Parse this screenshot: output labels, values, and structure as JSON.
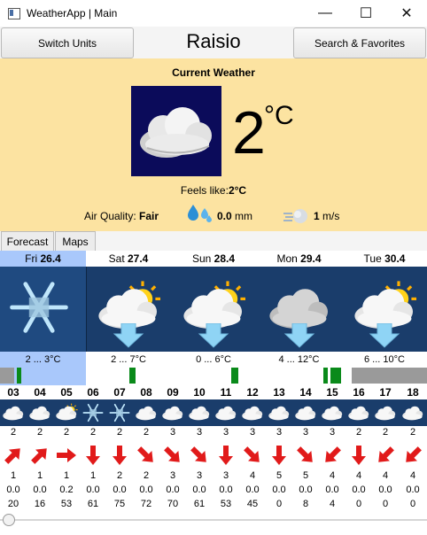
{
  "window": {
    "title": "WeatherApp | Main",
    "controls": {
      "minimize": "—",
      "maximize": "☐",
      "close": "✕"
    }
  },
  "header": {
    "switch_units": "Switch Units",
    "city": "Raisio",
    "search": "Search & Favorites"
  },
  "current": {
    "title": "Current Weather",
    "temp": "2",
    "unit": "°C",
    "feels_label": "Feels like:",
    "feels_value": "2°C",
    "aq_label": "Air Quality:",
    "aq_value": "Fair",
    "rain_value": "0.0",
    "rain_unit": "mm",
    "wind_value": "1",
    "wind_unit": "m/s"
  },
  "tabs": [
    "Forecast",
    "Maps"
  ],
  "days": [
    {
      "name": "Fri",
      "date": "26.4",
      "range": "2 ... 3°C",
      "icon": "snow-icon",
      "selected": true
    },
    {
      "name": "Sat",
      "date": "27.4",
      "range": "2 ... 7°C",
      "icon": "partly-cloudy-icon"
    },
    {
      "name": "Sun",
      "date": "28.4",
      "range": "0 ... 6°C",
      "icon": "partly-cloudy-icon"
    },
    {
      "name": "Mon",
      "date": "29.4",
      "range": "4 ... 12°C",
      "icon": "cloudy-icon"
    },
    {
      "name": "Tue",
      "date": "30.4",
      "range": "6 ... 10°C",
      "icon": "partly-cloudy-icon"
    }
  ],
  "hours": [
    {
      "h": "03",
      "icon": "cloud",
      "temp": "2",
      "wind": "1",
      "rain": "0.0",
      "prob": "20",
      "dir": "NE"
    },
    {
      "h": "04",
      "icon": "cloud",
      "temp": "2",
      "wind": "1",
      "rain": "0.0",
      "prob": "16",
      "dir": "NE"
    },
    {
      "h": "05",
      "icon": "sun-cloud",
      "temp": "2",
      "wind": "1",
      "rain": "0.2",
      "prob": "53",
      "dir": "E"
    },
    {
      "h": "06",
      "icon": "snow",
      "temp": "2",
      "wind": "1",
      "rain": "0.0",
      "prob": "61",
      "dir": "S"
    },
    {
      "h": "07",
      "icon": "snow",
      "temp": "2",
      "wind": "2",
      "rain": "0.0",
      "prob": "75",
      "dir": "S"
    },
    {
      "h": "08",
      "icon": "cloud",
      "temp": "2",
      "wind": "2",
      "rain": "0.0",
      "prob": "72",
      "dir": "SE"
    },
    {
      "h": "09",
      "icon": "cloud",
      "temp": "3",
      "wind": "3",
      "rain": "0.0",
      "prob": "70",
      "dir": "SE"
    },
    {
      "h": "10",
      "icon": "cloud",
      "temp": "3",
      "wind": "3",
      "rain": "0.0",
      "prob": "61",
      "dir": "SE"
    },
    {
      "h": "11",
      "icon": "cloud",
      "temp": "3",
      "wind": "3",
      "rain": "0.0",
      "prob": "53",
      "dir": "S"
    },
    {
      "h": "12",
      "icon": "cloud",
      "temp": "3",
      "wind": "4",
      "rain": "0.0",
      "prob": "45",
      "dir": "SE"
    },
    {
      "h": "13",
      "icon": "cloud",
      "temp": "3",
      "wind": "5",
      "rain": "0.0",
      "prob": "0",
      "dir": "S"
    },
    {
      "h": "14",
      "icon": "cloud",
      "temp": "3",
      "wind": "5",
      "rain": "0.0",
      "prob": "8",
      "dir": "SE"
    },
    {
      "h": "15",
      "icon": "cloud",
      "temp": "3",
      "wind": "4",
      "rain": "0.0",
      "prob": "4",
      "dir": "SW"
    },
    {
      "h": "16",
      "icon": "cloud",
      "temp": "2",
      "wind": "4",
      "rain": "0.0",
      "prob": "0",
      "dir": "S"
    },
    {
      "h": "17",
      "icon": "cloud",
      "temp": "2",
      "wind": "4",
      "rain": "0.0",
      "prob": "0",
      "dir": "SW"
    },
    {
      "h": "18",
      "icon": "cloud",
      "temp": "2",
      "wind": "4",
      "rain": "0.0",
      "prob": "0",
      "dir": "SW"
    }
  ],
  "colors": {
    "current_bg": "#fce3a1",
    "forecast_bg": "#1a3d6b",
    "selected_day": "#a9c8fb",
    "icon_bg": "#0b0b5a",
    "arrow": "#e11a1a",
    "green": "#0a8a1a",
    "gray": "#9a9a9a"
  }
}
